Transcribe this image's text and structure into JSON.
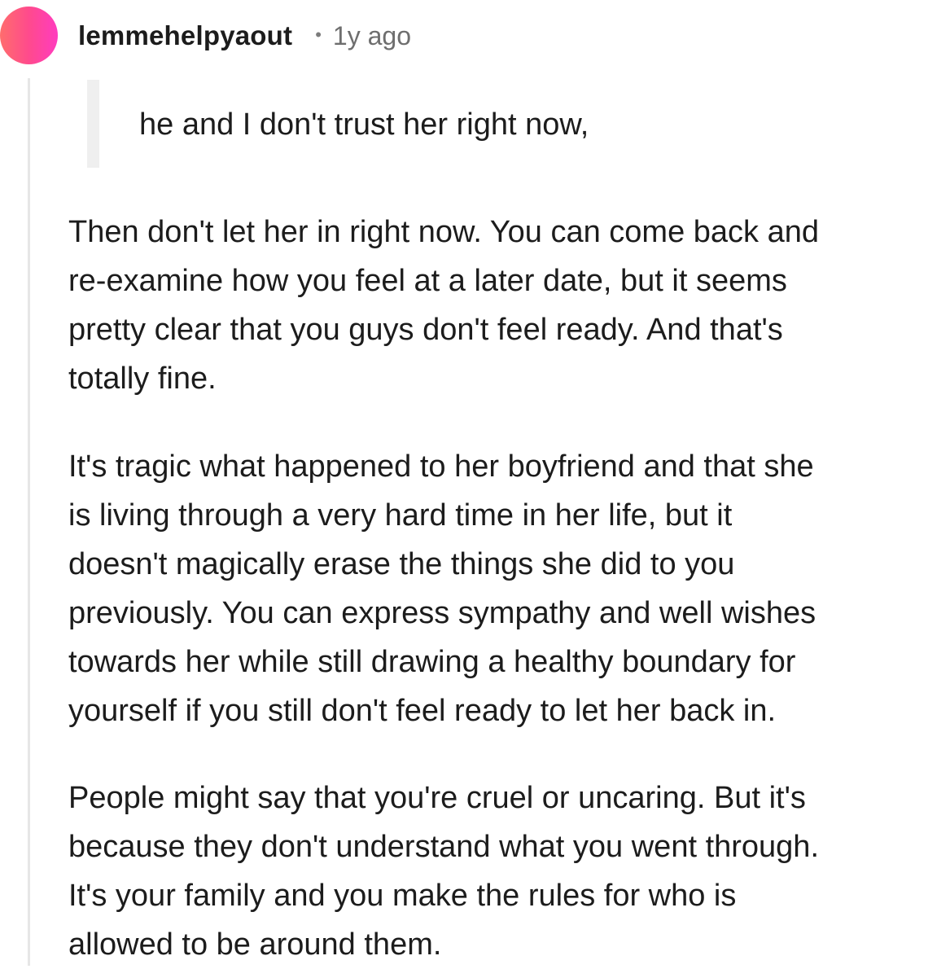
{
  "comment": {
    "username": "lemmehelpyaout",
    "separator": "•",
    "timestamp": "1y ago",
    "quote": "he and I don't trust her right now,",
    "paragraphs": [
      {
        "lines": [
          "Then don't let her in right now. You can come back and",
          "re-examine how you feel at a later date, but it seems",
          "pretty clear that you guys don't feel ready. And that's",
          "totally fine."
        ]
      },
      {
        "lines": [
          "It's tragic what happened to her boyfriend and that she",
          "is living through a very hard time in her life, but it",
          "doesn't magically erase the things she did to you",
          "previously. You can express sympathy and well wishes",
          "towards her while still drawing a healthy boundary for",
          "yourself if you still don't feel ready to let her back in."
        ]
      },
      {
        "lines": [
          "People might say that you're cruel or uncaring. But it's",
          "because they don't understand what you went through.",
          "It's your family and you make the rules for who is",
          "allowed to be around them."
        ]
      }
    ]
  },
  "colors": {
    "avatar_gradient_start": "#ff6d6d",
    "avatar_gradient_end": "#ff3cbf",
    "text": "#1c1c1c",
    "meta_text": "#6e6e6e",
    "thread_line": "#e6e6e6",
    "quote_bar": "#efefef"
  }
}
